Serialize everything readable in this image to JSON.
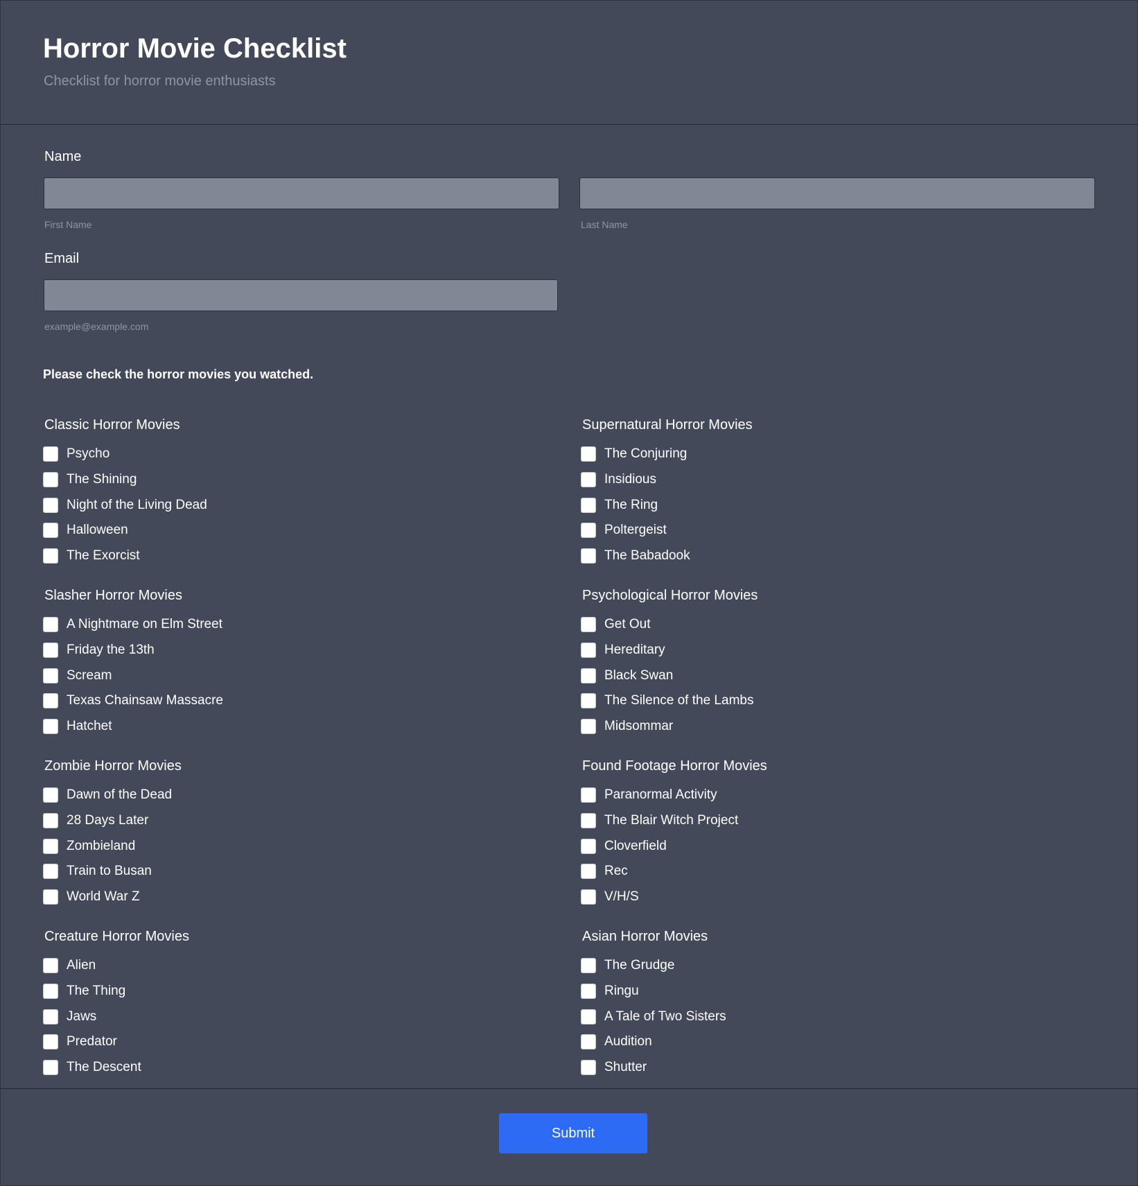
{
  "header": {
    "title": "Horror Movie Checklist",
    "subtitle": "Checklist for horror movie enthusiasts"
  },
  "name_field": {
    "label": "Name",
    "first_name_value": "",
    "first_name_sublabel": "First Name",
    "last_name_value": "",
    "last_name_sublabel": "Last Name"
  },
  "email_field": {
    "label": "Email",
    "value": "",
    "sublabel": "example@example.com"
  },
  "instruction": "Please check the horror movies you watched.",
  "groups": [
    {
      "title": "Classic Horror Movies",
      "options": [
        {
          "label": "Psycho",
          "checked": false
        },
        {
          "label": "The Shining",
          "checked": false
        },
        {
          "label": "Night of the Living Dead",
          "checked": false
        },
        {
          "label": "Halloween",
          "checked": false
        },
        {
          "label": "The Exorcist",
          "checked": false
        }
      ]
    },
    {
      "title": "Supernatural Horror Movies",
      "options": [
        {
          "label": "The Conjuring",
          "checked": false
        },
        {
          "label": "Insidious",
          "checked": false
        },
        {
          "label": "The Ring",
          "checked": false
        },
        {
          "label": "Poltergeist",
          "checked": false
        },
        {
          "label": "The Babadook",
          "checked": false
        }
      ]
    },
    {
      "title": "Slasher Horror Movies",
      "options": [
        {
          "label": "A Nightmare on Elm Street",
          "checked": false
        },
        {
          "label": "Friday the 13th",
          "checked": false
        },
        {
          "label": "Scream",
          "checked": false
        },
        {
          "label": "Texas Chainsaw Massacre",
          "checked": false
        },
        {
          "label": "Hatchet",
          "checked": false
        }
      ]
    },
    {
      "title": "Psychological Horror Movies",
      "options": [
        {
          "label": "Get Out",
          "checked": false
        },
        {
          "label": "Hereditary",
          "checked": false
        },
        {
          "label": "Black Swan",
          "checked": false
        },
        {
          "label": "The Silence of the Lambs",
          "checked": false
        },
        {
          "label": "Midsommar",
          "checked": false
        }
      ]
    },
    {
      "title": "Zombie Horror Movies",
      "options": [
        {
          "label": "Dawn of the Dead",
          "checked": false
        },
        {
          "label": "28 Days Later",
          "checked": false
        },
        {
          "label": "Zombieland",
          "checked": false
        },
        {
          "label": "Train to Busan",
          "checked": false
        },
        {
          "label": "World War Z",
          "checked": false
        }
      ]
    },
    {
      "title": "Found Footage Horror Movies",
      "options": [
        {
          "label": "Paranormal Activity",
          "checked": false
        },
        {
          "label": "The Blair Witch Project",
          "checked": false
        },
        {
          "label": "Cloverfield",
          "checked": false
        },
        {
          "label": "Rec",
          "checked": false
        },
        {
          "label": "V/H/S",
          "checked": false
        }
      ]
    },
    {
      "title": "Creature Horror Movies",
      "options": [
        {
          "label": "Alien",
          "checked": false
        },
        {
          "label": "The Thing",
          "checked": false
        },
        {
          "label": "Jaws",
          "checked": false
        },
        {
          "label": "Predator",
          "checked": false
        },
        {
          "label": "The Descent",
          "checked": false
        }
      ]
    },
    {
      "title": "Asian Horror Movies",
      "options": [
        {
          "label": "The Grudge",
          "checked": false
        },
        {
          "label": "Ringu",
          "checked": false
        },
        {
          "label": "A Tale of Two Sisters",
          "checked": false
        },
        {
          "label": "Audition",
          "checked": false
        },
        {
          "label": "Shutter",
          "checked": false
        }
      ]
    }
  ],
  "submit_label": "Submit",
  "colors": {
    "background": "#434959",
    "input_fill": "#818795",
    "muted_text": "#8f95a3",
    "submit_button": "#2e6bf5"
  }
}
